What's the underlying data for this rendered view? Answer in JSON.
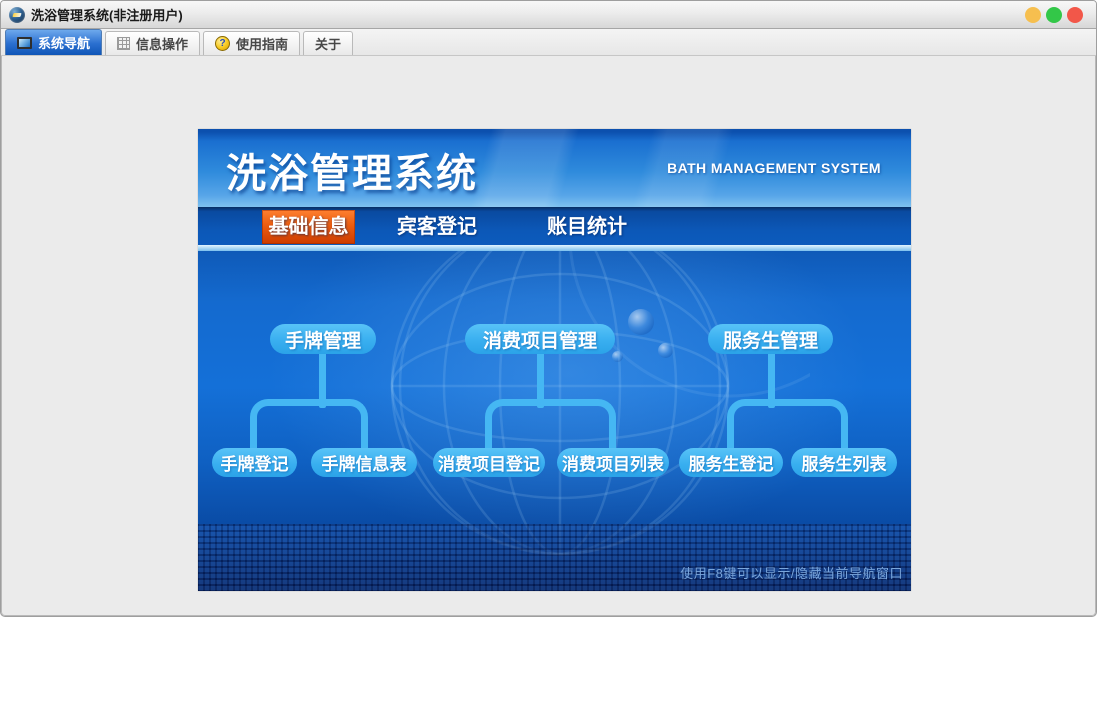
{
  "window": {
    "title": "洗浴管理系统(非注册用户)"
  },
  "titlebar_buttons": {
    "minimize_color": "#f6bf4f",
    "zoom_color": "#33c748",
    "close_color": "#f25749"
  },
  "tabs": [
    {
      "label": "系统导航",
      "icon": "form-icon",
      "selected": true
    },
    {
      "label": "信息操作",
      "icon": "grid-icon",
      "selected": false
    },
    {
      "label": "使用指南",
      "icon": "help-coin-icon",
      "selected": false
    },
    {
      "label": "关于",
      "icon": "",
      "selected": false
    }
  ],
  "panel": {
    "title": "洗浴管理系统",
    "subtitle": "BATH MANAGEMENT SYSTEM",
    "menu": [
      {
        "label": "基础信息",
        "selected": true
      },
      {
        "label": "宾客登记",
        "selected": false
      },
      {
        "label": "账目统计",
        "selected": false
      }
    ],
    "tree": [
      {
        "parent": "手牌管理",
        "children": [
          "手牌登记",
          "手牌信息表"
        ]
      },
      {
        "parent": "消费项目管理",
        "children": [
          "消费项目登记",
          "消费项目列表"
        ]
      },
      {
        "parent": "服务生管理",
        "children": [
          "服务生登记",
          "服务生列表"
        ]
      }
    ],
    "hint": "使用F8键可以显示/隐藏当前导航窗口",
    "colors": {
      "node_blue": "#45b7f3",
      "menu_selected_orange": "#e85c10",
      "navbar_blue": "#0c58b8",
      "body_blue": "#1268cd",
      "header_blue": "#2f8bdc"
    }
  }
}
